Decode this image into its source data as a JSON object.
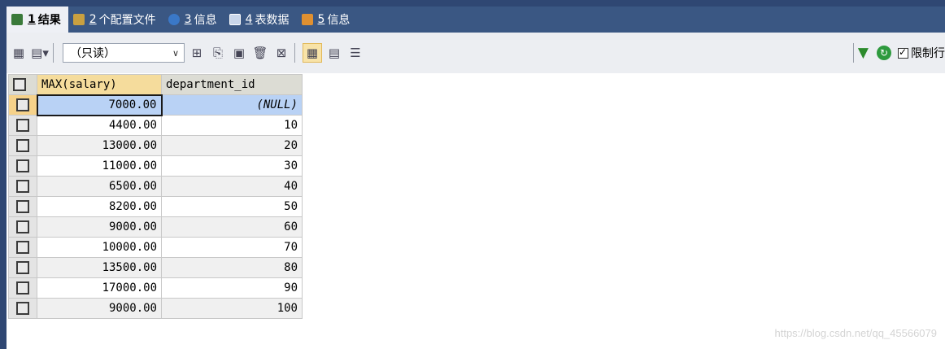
{
  "tabs": [
    {
      "num": "1",
      "label": "结果",
      "active": true,
      "color": "#3a7a3a"
    },
    {
      "num": "2",
      "label": "个配置文件",
      "active": false,
      "color": "#c9a040"
    },
    {
      "num": "3",
      "label": "信息",
      "active": false,
      "color": "#3a78c8"
    },
    {
      "num": "4",
      "label": "表数据",
      "active": false,
      "color": "#6a8ab8"
    },
    {
      "num": "5",
      "label": "信息",
      "active": false,
      "color": "#e09030"
    }
  ],
  "toolbar": {
    "mode_value": "（只读）",
    "limit_label": "限制行"
  },
  "grid": {
    "columns": [
      "MAX(salary)",
      "department_id"
    ],
    "rows": [
      [
        "7000.00",
        "(NULL)"
      ],
      [
        "4400.00",
        "10"
      ],
      [
        "13000.00",
        "20"
      ],
      [
        "11000.00",
        "30"
      ],
      [
        "6500.00",
        "40"
      ],
      [
        "8200.00",
        "50"
      ],
      [
        "9000.00",
        "60"
      ],
      [
        "10000.00",
        "70"
      ],
      [
        "13500.00",
        "80"
      ],
      [
        "17000.00",
        "90"
      ],
      [
        "9000.00",
        "100"
      ]
    ]
  },
  "watermark": "https://blog.csdn.net/qq_45566079"
}
